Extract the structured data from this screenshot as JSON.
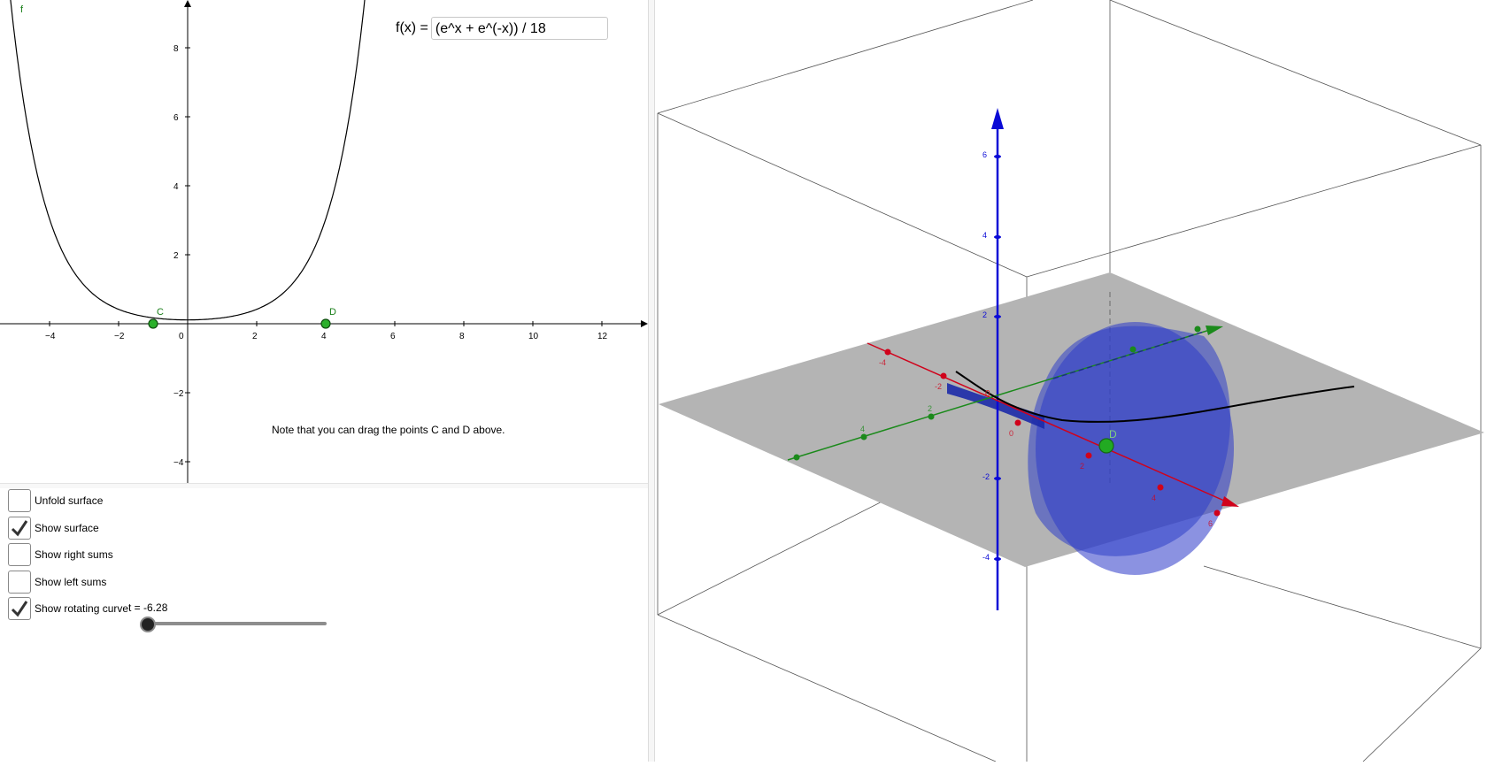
{
  "graph2d": {
    "function_label": "f",
    "x_ticks": [
      "−4",
      "−2",
      "0",
      "2",
      "4",
      "6",
      "8",
      "10",
      "12"
    ],
    "y_ticks": [
      "8",
      "6",
      "4",
      "2",
      "−2",
      "−4"
    ],
    "points": [
      {
        "name": "C",
        "x": -1,
        "color": "#1a7f1a"
      },
      {
        "name": "D",
        "x": 4,
        "color": "#1a7f1a"
      }
    ],
    "curve_color": "#000000"
  },
  "input": {
    "label": "f(x) =",
    "value": "(e^x + e^(-x)) / 18"
  },
  "note": "Note that you can drag the points C and D above.",
  "controls": {
    "checkboxes": [
      {
        "label": "Unfold surface",
        "checked": false
      },
      {
        "label": "Show surface",
        "checked": true
      },
      {
        "label": "Show right sums",
        "checked": false
      },
      {
        "label": "Show left sums",
        "checked": false
      },
      {
        "label": "Show rotating curve",
        "checked": true
      }
    ],
    "slider": {
      "label": "t = -6.28",
      "value": -6.28
    }
  },
  "graph3d": {
    "z_ticks": [
      "6",
      "4",
      "2",
      "-2",
      "-4"
    ],
    "x_ticks": [
      "-4",
      "-2",
      "0",
      "2",
      "4",
      "6"
    ],
    "y_ticks": [
      "4",
      "2"
    ],
    "origin_label": "0",
    "point_label": "D",
    "axis_colors": {
      "x": "#d0021b",
      "y": "#1b8a1b",
      "z": "#0a0ad6"
    },
    "surface_color": "#2233cc",
    "plane_color": "#b4b4b4"
  }
}
